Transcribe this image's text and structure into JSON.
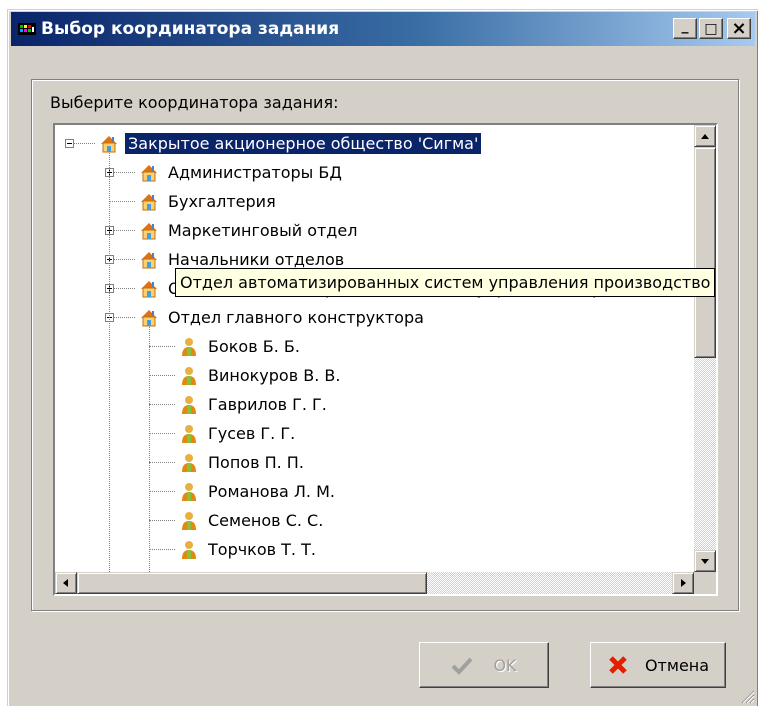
{
  "window": {
    "title": "Выбор координатора задания",
    "minimize_label": "_",
    "maximize_label": "□",
    "close_label": "×"
  },
  "prompt": "Выберите координатора задания:",
  "tree": {
    "root": "Закрытое акционерное общество 'Сигма'",
    "departments": [
      "Администраторы БД",
      "Бухгалтерия",
      "Маркетинговый отдел",
      "Начальники отделов",
      "Отдел автоматизированных систем управления производством",
      "Отдел главного конструктора"
    ],
    "employees": [
      "Боков Б. Б.",
      "Винокуров В. В.",
      "Гаврилов Г. Г.",
      "Гусев Г. Г.",
      "Попов П. П.",
      "Романова Л. М.",
      "Семенов С. С.",
      "Торчков Т. Т."
    ],
    "tooltip": "Отдел автоматизированных систем управления производство"
  },
  "buttons": {
    "ok": "OK",
    "cancel": "Отмена"
  },
  "icons": {
    "department": "house-icon",
    "employee": "person-icon",
    "ok": "checkmark-icon",
    "cancel": "red-x-icon"
  },
  "colors": {
    "title_gradient_start": "#0a246a",
    "title_gradient_end": "#a6caf0",
    "selection": "#0a246a",
    "tooltip_bg": "#ffffe1",
    "cancel_x": "#e02000"
  }
}
